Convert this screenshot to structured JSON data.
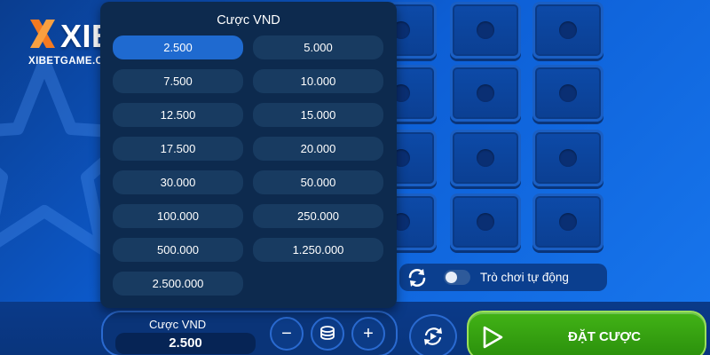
{
  "logo": {
    "brand": "XIBET",
    "site": "XIBETGAME.CLUB"
  },
  "bet_dropdown": {
    "title": "Cược VND",
    "selected": "2.500",
    "options": [
      "2.500",
      "5.000",
      "7.500",
      "10.000",
      "12.500",
      "15.000",
      "17.500",
      "20.000",
      "30.000",
      "50.000",
      "100.000",
      "250.000",
      "500.000",
      "1.250.000",
      "2.500.000"
    ]
  },
  "auto_play": {
    "label": "Trò chơi tự động",
    "enabled": false
  },
  "bet_panel": {
    "label": "Cược VND",
    "value": "2.500",
    "minus_label": "−",
    "plus_label": "+"
  },
  "place_bet": {
    "label": "ĐẶT CƯỢC"
  },
  "colors": {
    "background": "#0d5fd6",
    "panel": "#0d2a4e",
    "option": "#183b61",
    "option_selected": "#1f6ad0",
    "place_bet": "#3aa612",
    "logo_orange": "#f47a20"
  },
  "icons": [
    "logo-x-icon",
    "refresh-icon",
    "coin-stack-icon",
    "replay-icon",
    "play-icon",
    "star-decoration-icon"
  ]
}
